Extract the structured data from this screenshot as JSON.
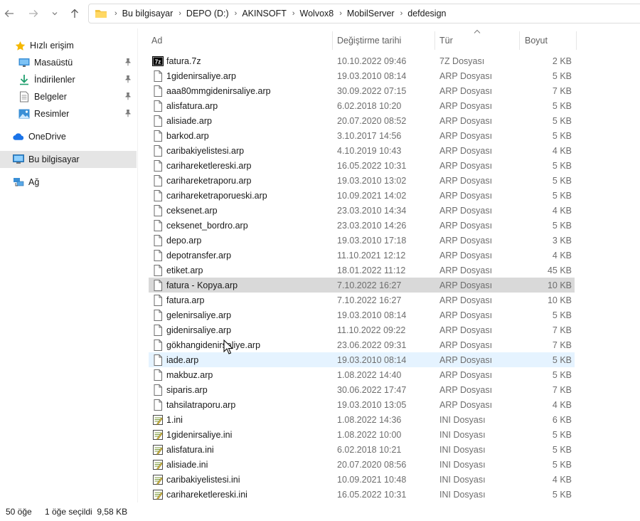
{
  "nav": {
    "back_icon": "arrow-left-icon",
    "forward_icon": "arrow-right-icon",
    "recent_icon": "chevron-down-icon",
    "up_icon": "arrow-up-icon"
  },
  "address": {
    "folder_icon": "folder-icon",
    "crumbs": [
      "Bu bilgisayar",
      "DEPO (D:)",
      "AKINSOFT",
      "Wolvox8",
      "MobilServer",
      "defdesign"
    ]
  },
  "sidebar": {
    "items": [
      {
        "label": "Hızlı erişim",
        "icon": "star-icon",
        "pinned": false,
        "selected": false
      },
      {
        "label": "Masaüstü",
        "icon": "desktop-icon",
        "pinned": true,
        "selected": false
      },
      {
        "label": "İndirilenler",
        "icon": "download-icon",
        "pinned": true,
        "selected": false
      },
      {
        "label": "Belgeler",
        "icon": "documents-icon",
        "pinned": true,
        "selected": false
      },
      {
        "label": "Resimler",
        "icon": "pictures-icon",
        "pinned": true,
        "selected": false
      },
      {
        "label": "OneDrive",
        "icon": "cloud-icon",
        "pinned": false,
        "selected": false
      },
      {
        "label": "Bu bilgisayar",
        "icon": "computer-icon",
        "pinned": false,
        "selected": true
      },
      {
        "label": "Ağ",
        "icon": "network-icon",
        "pinned": false,
        "selected": false
      }
    ]
  },
  "columns": {
    "name": "Ad",
    "date": "Değiştirme tarihi",
    "type": "Tür",
    "size": "Boyut"
  },
  "files": [
    {
      "name": "fatura.7z",
      "date": "10.10.2022 09:46",
      "type": "7Z Dosyası",
      "size": "2 KB",
      "icon": "archive-7z-icon",
      "state": ""
    },
    {
      "name": "1gidenirsaliye.arp",
      "date": "19.03.2010 08:14",
      "type": "ARP Dosyası",
      "size": "5 KB",
      "icon": "file-icon",
      "state": ""
    },
    {
      "name": "aaa80mmgidenirsaliye.arp",
      "date": "30.09.2022 07:15",
      "type": "ARP Dosyası",
      "size": "7 KB",
      "icon": "file-icon",
      "state": ""
    },
    {
      "name": "alisfatura.arp",
      "date": "6.02.2018 10:20",
      "type": "ARP Dosyası",
      "size": "5 KB",
      "icon": "file-icon",
      "state": ""
    },
    {
      "name": "alisiade.arp",
      "date": "20.07.2020 08:52",
      "type": "ARP Dosyası",
      "size": "5 KB",
      "icon": "file-icon",
      "state": ""
    },
    {
      "name": "barkod.arp",
      "date": "3.10.2017 14:56",
      "type": "ARP Dosyası",
      "size": "5 KB",
      "icon": "file-icon",
      "state": ""
    },
    {
      "name": "caribakiyelistesi.arp",
      "date": "4.10.2019 10:43",
      "type": "ARP Dosyası",
      "size": "4 KB",
      "icon": "file-icon",
      "state": ""
    },
    {
      "name": "carihareketlereski.arp",
      "date": "16.05.2022 10:31",
      "type": "ARP Dosyası",
      "size": "5 KB",
      "icon": "file-icon",
      "state": ""
    },
    {
      "name": "carihareketraporu.arp",
      "date": "19.03.2010 13:02",
      "type": "ARP Dosyası",
      "size": "5 KB",
      "icon": "file-icon",
      "state": ""
    },
    {
      "name": "carihareketraporueski.arp",
      "date": "10.09.2021 14:02",
      "type": "ARP Dosyası",
      "size": "5 KB",
      "icon": "file-icon",
      "state": ""
    },
    {
      "name": "ceksenet.arp",
      "date": "23.03.2010 14:34",
      "type": "ARP Dosyası",
      "size": "4 KB",
      "icon": "file-icon",
      "state": ""
    },
    {
      "name": "ceksenet_bordro.arp",
      "date": "23.03.2010 14:26",
      "type": "ARP Dosyası",
      "size": "5 KB",
      "icon": "file-icon",
      "state": ""
    },
    {
      "name": "depo.arp",
      "date": "19.03.2010 17:18",
      "type": "ARP Dosyası",
      "size": "3 KB",
      "icon": "file-icon",
      "state": ""
    },
    {
      "name": "depotransfer.arp",
      "date": "11.10.2021 12:12",
      "type": "ARP Dosyası",
      "size": "4 KB",
      "icon": "file-icon",
      "state": ""
    },
    {
      "name": "etiket.arp",
      "date": "18.01.2022 11:12",
      "type": "ARP Dosyası",
      "size": "45 KB",
      "icon": "file-icon",
      "state": ""
    },
    {
      "name": "fatura - Kopya.arp",
      "date": "7.10.2022 16:27",
      "type": "ARP Dosyası",
      "size": "10 KB",
      "icon": "file-icon",
      "state": "selected"
    },
    {
      "name": "fatura.arp",
      "date": "7.10.2022 16:27",
      "type": "ARP Dosyası",
      "size": "10 KB",
      "icon": "file-icon",
      "state": ""
    },
    {
      "name": "gelenirsaliye.arp",
      "date": "19.03.2010 08:14",
      "type": "ARP Dosyası",
      "size": "5 KB",
      "icon": "file-icon",
      "state": ""
    },
    {
      "name": "gidenirsaliye.arp",
      "date": "11.10.2022 09:22",
      "type": "ARP Dosyası",
      "size": "7 KB",
      "icon": "file-icon",
      "state": ""
    },
    {
      "name": "gökhangidenirsaliye.arp",
      "date": "23.06.2022 09:31",
      "type": "ARP Dosyası",
      "size": "7 KB",
      "icon": "file-icon",
      "state": ""
    },
    {
      "name": "iade.arp",
      "date": "19.03.2010 08:14",
      "type": "ARP Dosyası",
      "size": "5 KB",
      "icon": "file-icon",
      "state": "hover"
    },
    {
      "name": "makbuz.arp",
      "date": "1.08.2022 14:40",
      "type": "ARP Dosyası",
      "size": "5 KB",
      "icon": "file-icon",
      "state": ""
    },
    {
      "name": "siparis.arp",
      "date": "30.06.2022 17:47",
      "type": "ARP Dosyası",
      "size": "7 KB",
      "icon": "file-icon",
      "state": ""
    },
    {
      "name": "tahsilatraporu.arp",
      "date": "19.03.2010 13:05",
      "type": "ARP Dosyası",
      "size": "4 KB",
      "icon": "file-icon",
      "state": ""
    },
    {
      "name": "1.ini",
      "date": "1.08.2022 14:36",
      "type": "INI Dosyası",
      "size": "6 KB",
      "icon": "ini-file-icon",
      "state": ""
    },
    {
      "name": "1gidenirsaliye.ini",
      "date": "1.08.2022 10:00",
      "type": "INI Dosyası",
      "size": "5 KB",
      "icon": "ini-file-icon",
      "state": ""
    },
    {
      "name": "alisfatura.ini",
      "date": "6.02.2018 10:21",
      "type": "INI Dosyası",
      "size": "5 KB",
      "icon": "ini-file-icon",
      "state": ""
    },
    {
      "name": "alisiade.ini",
      "date": "20.07.2020 08:56",
      "type": "INI Dosyası",
      "size": "5 KB",
      "icon": "ini-file-icon",
      "state": ""
    },
    {
      "name": "caribakiyelistesi.ini",
      "date": "10.09.2021 10:48",
      "type": "INI Dosyası",
      "size": "4 KB",
      "icon": "ini-file-icon",
      "state": ""
    },
    {
      "name": "carihareketlereski.ini",
      "date": "16.05.2022 10:31",
      "type": "INI Dosyası",
      "size": "5 KB",
      "icon": "ini-file-icon",
      "state": ""
    }
  ],
  "status": {
    "item_count": "50 öğe",
    "selection": "1 öğe seçildi  9,58 KB"
  },
  "colors": {
    "selected_row": "#d9d9d9",
    "hover_row": "#e5f3ff",
    "sidebar_selected": "#e5e5e5",
    "accent": "#0067c0"
  }
}
